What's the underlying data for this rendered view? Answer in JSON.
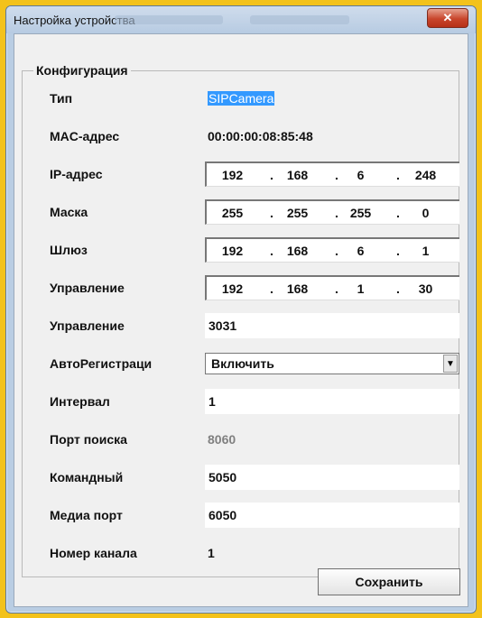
{
  "window": {
    "title": "Настройка устройства",
    "close_symbol": "✕"
  },
  "group": {
    "title": "Конфигурация"
  },
  "fields": {
    "type": {
      "label": "Тип",
      "value": "SIPCamera"
    },
    "mac": {
      "label": "MAC-адрес",
      "value": "00:00:00:08:85:48"
    },
    "ip": {
      "label": "IP-адрес",
      "octets": [
        "192",
        "168",
        "6",
        "248"
      ]
    },
    "mask": {
      "label": "Маска",
      "octets": [
        "255",
        "255",
        "255",
        "0"
      ]
    },
    "gateway": {
      "label": "Шлюз",
      "octets": [
        "192",
        "168",
        "6",
        "1"
      ]
    },
    "control_ip": {
      "label": "Управление",
      "octets": [
        "192",
        "168",
        "1",
        "30"
      ]
    },
    "control_port": {
      "label": "Управление",
      "value": "3031"
    },
    "autoreg": {
      "label": "АвтоРегистраци",
      "value": "Включить"
    },
    "interval": {
      "label": "Интервал",
      "value": "1"
    },
    "search_port": {
      "label": "Порт поиска",
      "value": "8060"
    },
    "command": {
      "label": "Командный",
      "value": "5050"
    },
    "media_port": {
      "label": "Медиа порт",
      "value": "6050"
    },
    "channel": {
      "label": "Номер канала",
      "value": "1"
    }
  },
  "buttons": {
    "save": "Сохранить"
  },
  "icons": {
    "close": "close-icon",
    "dropdown": "chevron-down-icon"
  }
}
